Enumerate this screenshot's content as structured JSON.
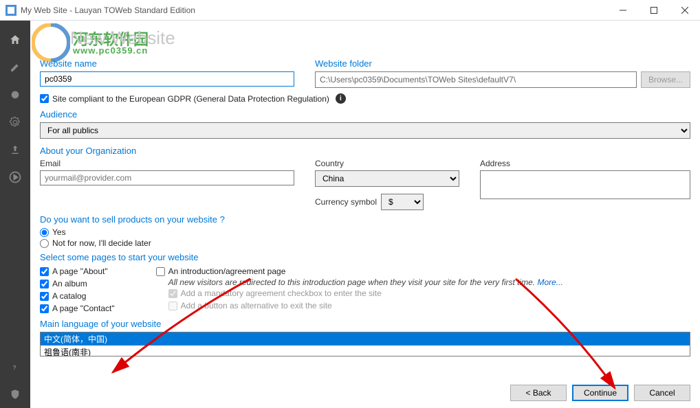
{
  "window": {
    "title": "My Web Site - Lauyan TOWeb Standard Edition"
  },
  "watermark": {
    "line1": "河东软件园",
    "line2": "www.pc0359.cn"
  },
  "heading": "New Website",
  "website_name": {
    "label": "Website name",
    "value": "pc0359"
  },
  "website_folder": {
    "label": "Website folder",
    "value": "C:\\Users\\pc0359\\Documents\\TOWeb Sites\\defaultV7\\",
    "browse": "Browse..."
  },
  "gdpr": {
    "label": "Site compliant to the European GDPR (General Data Protection Regulation)"
  },
  "audience": {
    "label": "Audience",
    "value": "For all publics"
  },
  "org": {
    "heading": "About your Organization",
    "email_label": "Email",
    "email_placeholder": "yourmail@provider.com",
    "country_label": "Country",
    "country_value": "China",
    "address_label": "Address",
    "currency_label": "Currency symbol",
    "currency_value": "$"
  },
  "sell": {
    "heading": "Do you want to sell products on your website ?",
    "yes": "Yes",
    "no": "Not for now, I'll decide later"
  },
  "pages": {
    "heading": "Select some pages to start your website",
    "about": "A page \"About\"",
    "album": "An album",
    "catalog": "A catalog",
    "contact": "A page \"Contact\"",
    "intro": "An introduction/agreement page",
    "intro_hint": "All new visitors are redirected to this introduction page when they visit your site for the very first time.",
    "more": "More...",
    "mandatory": "Add a mandatory agreement checkbox to enter the site",
    "exit_btn": "Add a button as alternative to exit the site"
  },
  "lang": {
    "heading": "Main language of your website",
    "options": [
      "中文(简体，中国)",
      "祖鲁语(南非)"
    ]
  },
  "buttons": {
    "back": "< Back",
    "continue": "Continue",
    "cancel": "Cancel"
  }
}
